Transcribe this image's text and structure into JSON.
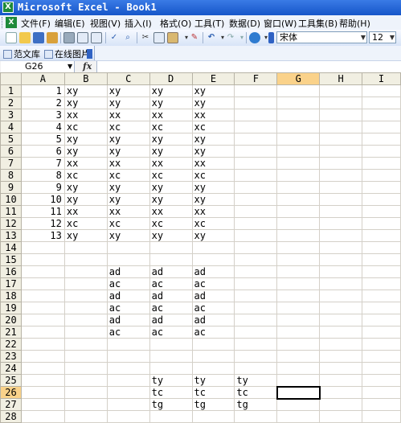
{
  "window": {
    "title": "Microsoft Excel - Book1",
    "app_icon": "excel-icon"
  },
  "menu": [
    {
      "label": "文件(F)"
    },
    {
      "label": "编辑(E)"
    },
    {
      "label": "视图(V)"
    },
    {
      "label": "插入(I)"
    },
    {
      "label": "格式(O)"
    },
    {
      "label": "工具(T)"
    },
    {
      "label": "数据(D)"
    },
    {
      "label": "窗口(W)"
    },
    {
      "label": "工具集(B)"
    },
    {
      "label": "帮助(H)"
    }
  ],
  "toolbar": {
    "font": "宋体",
    "size": "12"
  },
  "toolbar2": {
    "items": [
      {
        "label": "范文库"
      },
      {
        "label": "在线图片"
      }
    ]
  },
  "formula_bar": {
    "name_box": "G26",
    "fx": "fx",
    "formula": ""
  },
  "grid": {
    "columns": [
      "A",
      "B",
      "C",
      "D",
      "E",
      "F",
      "G",
      "H",
      "I"
    ],
    "active_column": "G",
    "active_row": 26,
    "rows": [
      {
        "n": "1",
        "A": "1",
        "B": "xy",
        "C": "xy",
        "D": "xy",
        "E": "xy",
        "F": "",
        "G": "",
        "H": "",
        "I": ""
      },
      {
        "n": "2",
        "A": "2",
        "B": "xy",
        "C": "xy",
        "D": "xy",
        "E": "xy",
        "F": "",
        "G": "",
        "H": "",
        "I": ""
      },
      {
        "n": "3",
        "A": "3",
        "B": "xx",
        "C": "xx",
        "D": "xx",
        "E": "xx",
        "F": "",
        "G": "",
        "H": "",
        "I": ""
      },
      {
        "n": "4",
        "A": "4",
        "B": "xc",
        "C": "xc",
        "D": "xc",
        "E": "xc",
        "F": "",
        "G": "",
        "H": "",
        "I": ""
      },
      {
        "n": "5",
        "A": "5",
        "B": "xy",
        "C": "xy",
        "D": "xy",
        "E": "xy",
        "F": "",
        "G": "",
        "H": "",
        "I": ""
      },
      {
        "n": "6",
        "A": "6",
        "B": "xy",
        "C": "xy",
        "D": "xy",
        "E": "xy",
        "F": "",
        "G": "",
        "H": "",
        "I": ""
      },
      {
        "n": "7",
        "A": "7",
        "B": "xx",
        "C": "xx",
        "D": "xx",
        "E": "xx",
        "F": "",
        "G": "",
        "H": "",
        "I": ""
      },
      {
        "n": "8",
        "A": "8",
        "B": "xc",
        "C": "xc",
        "D": "xc",
        "E": "xc",
        "F": "",
        "G": "",
        "H": "",
        "I": ""
      },
      {
        "n": "9",
        "A": "9",
        "B": "xy",
        "C": "xy",
        "D": "xy",
        "E": "xy",
        "F": "",
        "G": "",
        "H": "",
        "I": ""
      },
      {
        "n": "10",
        "A": "10",
        "B": "xy",
        "C": "xy",
        "D": "xy",
        "E": "xy",
        "F": "",
        "G": "",
        "H": "",
        "I": ""
      },
      {
        "n": "11",
        "A": "11",
        "B": "xx",
        "C": "xx",
        "D": "xx",
        "E": "xx",
        "F": "",
        "G": "",
        "H": "",
        "I": ""
      },
      {
        "n": "12",
        "A": "12",
        "B": "xc",
        "C": "xc",
        "D": "xc",
        "E": "xc",
        "F": "",
        "G": "",
        "H": "",
        "I": ""
      },
      {
        "n": "13",
        "A": "13",
        "B": "xy",
        "C": "xy",
        "D": "xy",
        "E": "xy",
        "F": "",
        "G": "",
        "H": "",
        "I": ""
      },
      {
        "n": "14",
        "A": "",
        "B": "",
        "C": "",
        "D": "",
        "E": "",
        "F": "",
        "G": "",
        "H": "",
        "I": ""
      },
      {
        "n": "15",
        "A": "",
        "B": "",
        "C": "",
        "D": "",
        "E": "",
        "F": "",
        "G": "",
        "H": "",
        "I": ""
      },
      {
        "n": "16",
        "A": "",
        "B": "",
        "C": "ad",
        "D": "ad",
        "E": "ad",
        "F": "",
        "G": "",
        "H": "",
        "I": ""
      },
      {
        "n": "17",
        "A": "",
        "B": "",
        "C": "ac",
        "D": "ac",
        "E": "ac",
        "F": "",
        "G": "",
        "H": "",
        "I": ""
      },
      {
        "n": "18",
        "A": "",
        "B": "",
        "C": "ad",
        "D": "ad",
        "E": "ad",
        "F": "",
        "G": "",
        "H": "",
        "I": ""
      },
      {
        "n": "19",
        "A": "",
        "B": "",
        "C": "ac",
        "D": "ac",
        "E": "ac",
        "F": "",
        "G": "",
        "H": "",
        "I": ""
      },
      {
        "n": "20",
        "A": "",
        "B": "",
        "C": "ad",
        "D": "ad",
        "E": "ad",
        "F": "",
        "G": "",
        "H": "",
        "I": ""
      },
      {
        "n": "21",
        "A": "",
        "B": "",
        "C": "ac",
        "D": "ac",
        "E": "ac",
        "F": "",
        "G": "",
        "H": "",
        "I": ""
      },
      {
        "n": "22",
        "A": "",
        "B": "",
        "C": "",
        "D": "",
        "E": "",
        "F": "",
        "G": "",
        "H": "",
        "I": ""
      },
      {
        "n": "23",
        "A": "",
        "B": "",
        "C": "",
        "D": "",
        "E": "",
        "F": "",
        "G": "",
        "H": "",
        "I": ""
      },
      {
        "n": "24",
        "A": "",
        "B": "",
        "C": "",
        "D": "",
        "E": "",
        "F": "",
        "G": "",
        "H": "",
        "I": ""
      },
      {
        "n": "25",
        "A": "",
        "B": "",
        "C": "",
        "D": "ty",
        "E": "ty",
        "F": "ty",
        "G": "",
        "H": "",
        "I": ""
      },
      {
        "n": "26",
        "A": "",
        "B": "",
        "C": "",
        "D": "tc",
        "E": "tc",
        "F": "tc",
        "G": "",
        "H": "",
        "I": ""
      },
      {
        "n": "27",
        "A": "",
        "B": "",
        "C": "",
        "D": "tg",
        "E": "tg",
        "F": "tg",
        "G": "",
        "H": "",
        "I": ""
      },
      {
        "n": "28",
        "A": "",
        "B": "",
        "C": "",
        "D": "",
        "E": "",
        "F": "",
        "G": "",
        "H": "",
        "I": ""
      }
    ]
  }
}
